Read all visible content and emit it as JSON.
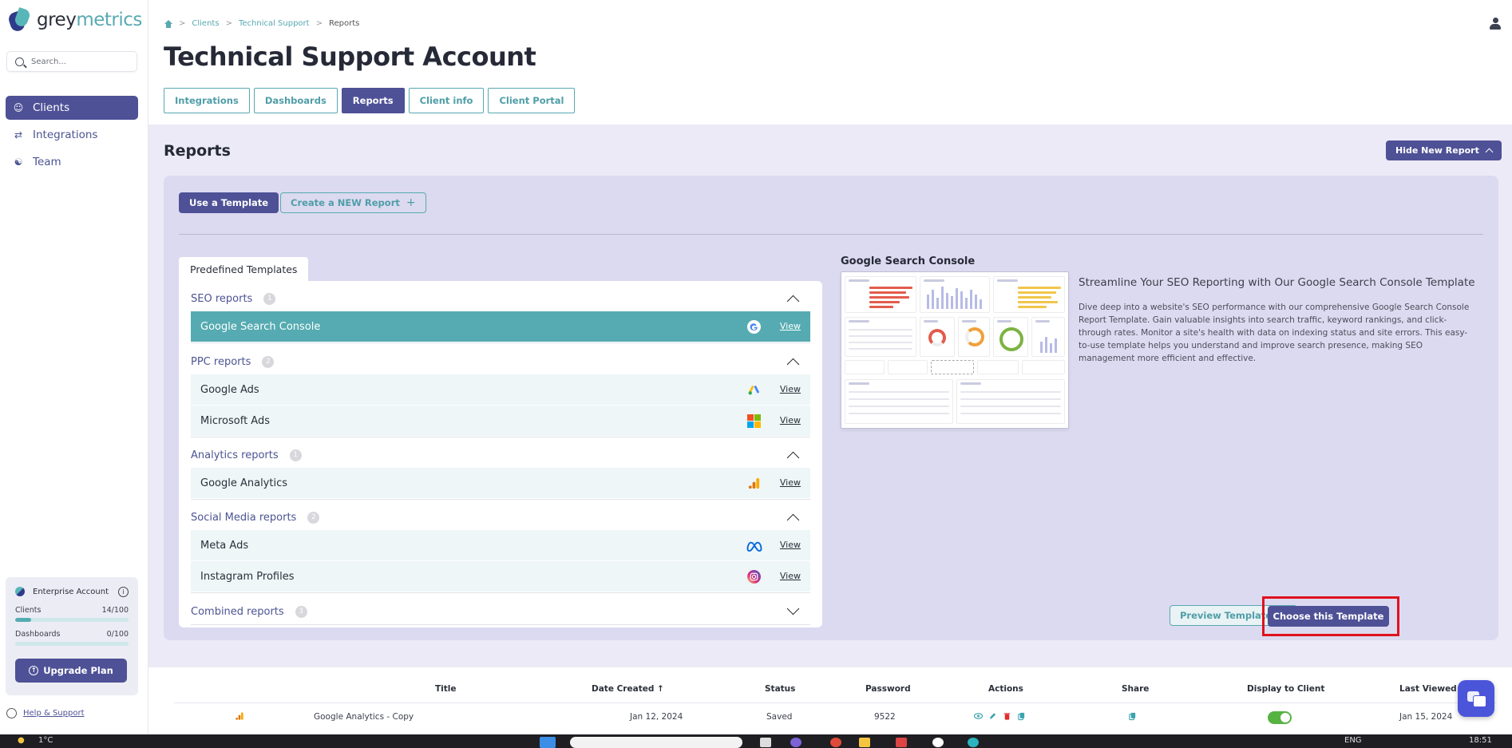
{
  "brand": {
    "name_a": "grey",
    "name_b": "metrics",
    "accent": "#4e5196",
    "teal": "#58a9b2"
  },
  "sidebar": {
    "search_placeholder": "Search...",
    "items": [
      {
        "label": "Clients",
        "icon": "user-icon"
      },
      {
        "label": "Integrations",
        "icon": "arrows-icon"
      },
      {
        "label": "Team",
        "icon": "team-icon"
      }
    ],
    "plan": {
      "name": "Enterprise Account",
      "clients_label": "Clients",
      "clients_value": "14/100",
      "clients_fraction": 0.14,
      "dashboards_label": "Dashboards",
      "dashboards_value": "0/100",
      "dashboards_fraction": 0.0,
      "upgrade_label": "Upgrade Plan"
    },
    "help_label": "Help & Support"
  },
  "header": {
    "breadcrumb": [
      "Clients",
      "Technical Support",
      "Reports"
    ],
    "title": "Technical Support Account",
    "tabs": [
      "Integrations",
      "Dashboards",
      "Reports",
      "Client info",
      "Client Portal"
    ]
  },
  "reports": {
    "title": "Reports",
    "hide_label": "Hide New Report",
    "use_template_label": "Use a Template",
    "create_label": "Create a NEW Report",
    "predefined_tab": "Predefined Templates",
    "categories": [
      {
        "name": "SEO reports",
        "count": "1",
        "items": [
          {
            "name": "Google Search Console",
            "view": "View"
          }
        ]
      },
      {
        "name": "PPC reports",
        "count": "2",
        "items": [
          {
            "name": "Google Ads",
            "view": "View"
          },
          {
            "name": "Microsoft Ads",
            "view": "View"
          }
        ]
      },
      {
        "name": "Analytics reports",
        "count": "1",
        "items": [
          {
            "name": "Google Analytics",
            "view": "View"
          }
        ]
      },
      {
        "name": "Social Media reports",
        "count": "2",
        "items": [
          {
            "name": "Meta Ads",
            "view": "View"
          },
          {
            "name": "Instagram Profiles",
            "view": "View"
          }
        ]
      },
      {
        "name": "Combined reports",
        "count": "3",
        "items": []
      }
    ],
    "selected_title": "Google Search Console",
    "desc_heading": "Streamline Your SEO Reporting with Our Google Search Console Template",
    "desc_body": "Dive deep into a website's SEO performance with our comprehensive Google Search Console Report Template. Gain valuable insights into search traffic, keyword rankings, and click-through rates. Monitor a site's health with data on indexing status and site errors. This easy-to-use template helps you understand and improve search presence, making SEO management more efficient and effective.",
    "preview_label": "Preview Template",
    "choose_label": "Choose this Template"
  },
  "table": {
    "headers": [
      "Title",
      "Date Created ↑",
      "Status",
      "Password",
      "Actions",
      "Share",
      "Display to Client",
      "Last Viewed"
    ],
    "rows": [
      {
        "title": "Google Analytics - Copy",
        "date": "Jan 12, 2024",
        "status": "Saved",
        "password": "9522",
        "last_viewed": "Jan 15, 2024",
        "display_to_client": true
      }
    ]
  },
  "taskbar": {
    "weather": "1°C",
    "lang": "ENG",
    "time": "18:51"
  }
}
